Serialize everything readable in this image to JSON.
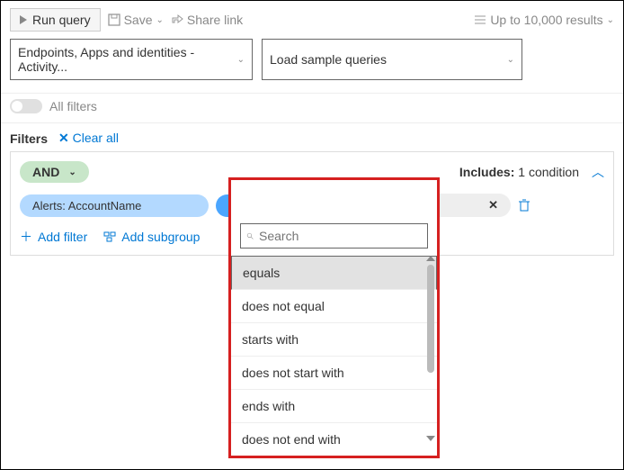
{
  "toolbar": {
    "run": "Run query",
    "save": "Save",
    "share": "Share link",
    "results": "Up to 10,000 results"
  },
  "selectors": {
    "scope": "Endpoints, Apps and identities - Activity...",
    "sample": "Load sample queries"
  },
  "filters": {
    "all": "All filters",
    "label": "Filters",
    "clear": "Clear all"
  },
  "group": {
    "logic": "AND",
    "includes_label": "Includes:",
    "includes_value": "1 condition",
    "field": "Alerts: AccountName",
    "operator": "equals",
    "search_placeholder": "Search",
    "add_filter": "Add filter",
    "add_subgroup": "Add subgroup"
  },
  "dropdown": {
    "search_placeholder": "Search",
    "items": [
      "equals",
      "does not equal",
      "starts with",
      "does not start with",
      "ends with",
      "does not end with"
    ]
  }
}
